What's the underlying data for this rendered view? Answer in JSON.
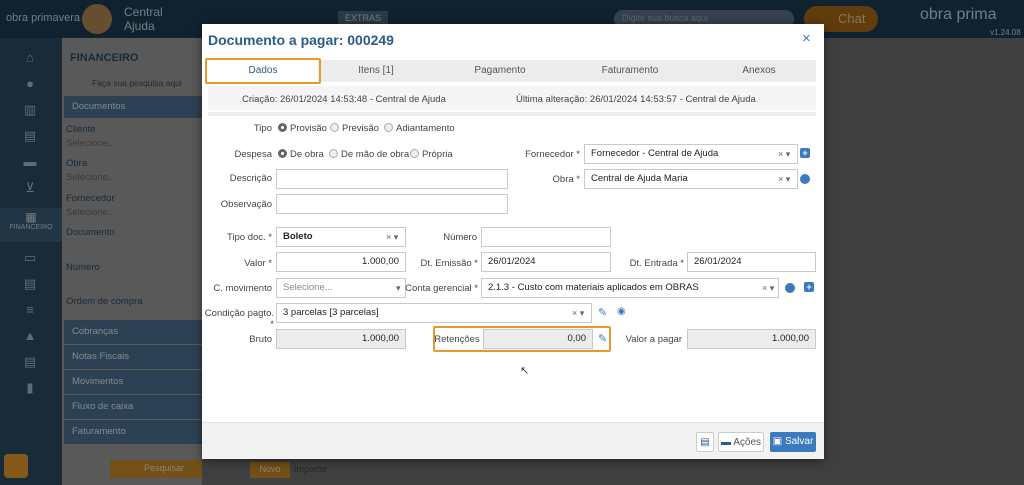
{
  "app": {
    "logo": "obra prima",
    "logo_small": "obra primavera",
    "user": "Central Ajuda",
    "extras": "EXTRAS",
    "search_placeholder": "Digite sua busca aqui",
    "chat": "Chat",
    "version": "v1.24.08"
  },
  "sidebar": {
    "title": "FINANCEIRO",
    "search_hint": "Faça sua pesquisa aqui",
    "section_documentos": "Documentos",
    "cliente_label": "Cliente",
    "cliente_ph": "Selecione...",
    "obra_label": "Obra",
    "obra_ph": "Selecione...",
    "fornecedor_label": "Fornecedor",
    "fornecedor_ph": "Selecione...",
    "documento_label": "Documento",
    "numero_label": "Número",
    "ordem_label": "Ordem de compra",
    "sections": [
      "Cobranças",
      "Notas Fiscais",
      "Movimentos",
      "Fluxo de caixa",
      "Faturamento"
    ],
    "pesquisar": "Pesquisar",
    "nav_active": "FINANCEIRO"
  },
  "content": {
    "btn_novo": "Novo",
    "btn_importar": "Importar"
  },
  "modal": {
    "title": "Documento a pagar: 000249",
    "tabs": [
      "Dados",
      "Itens [1]",
      "Pagamento",
      "Faturamento",
      "Anexos"
    ],
    "criacao_label": "Criação:",
    "criacao_value": "26/01/2024 14:53:48 - Central de Ajuda",
    "alteracao_label": "Última alteração:",
    "alteracao_value": "26/01/2024 14:53:57 - Central de Ajuda",
    "tipo": {
      "label": "Tipo",
      "options": [
        "Provisão",
        "Previsão",
        "Adiantamento"
      ],
      "selected": "Provisão"
    },
    "despesa": {
      "label": "Despesa",
      "options": [
        "De obra",
        "De mão de obra",
        "Própria"
      ],
      "selected": "De obra"
    },
    "fornecedor": {
      "label": "Fornecedor *",
      "value": "Fornecedor - Central de Ajuda"
    },
    "descricao": {
      "label": "Descrição",
      "value": ""
    },
    "obra": {
      "label": "Obra *",
      "value": "Central de Ajuda Maria"
    },
    "observacao": {
      "label": "Observação",
      "value": ""
    },
    "tipo_doc": {
      "label": "Tipo doc. *",
      "value": "Boleto"
    },
    "numero": {
      "label": "Número",
      "value": ""
    },
    "valor": {
      "label": "Valor *",
      "value": "1.000,00"
    },
    "dt_emissao": {
      "label": "Dt. Emissão *",
      "value": "26/01/2024"
    },
    "dt_entrada": {
      "label": "Dt. Entrada *",
      "value": "26/01/2024"
    },
    "c_movimento": {
      "label": "C. movimento",
      "placeholder": "Selecione..."
    },
    "conta_gerencial": {
      "label": "Conta gerencial *",
      "value": "2.1.3 - Custo com materiais aplicados em OBRAS"
    },
    "condicao": {
      "label": "Condição pagto. *",
      "value": "3 parcelas [3 parcelas]"
    },
    "bruto": {
      "label": "Bruto",
      "value": "1.000,00"
    },
    "retencoes": {
      "label": "Retenções",
      "value": "0,00"
    },
    "valor_pagar": {
      "label": "Valor a pagar",
      "value": "1.000,00"
    },
    "footer": {
      "acoes": "Ações",
      "salvar": "Salvar"
    }
  },
  "colors": {
    "accent": "#e69a2e",
    "primary": "#3a7abd",
    "title": "#2a5c8a"
  }
}
